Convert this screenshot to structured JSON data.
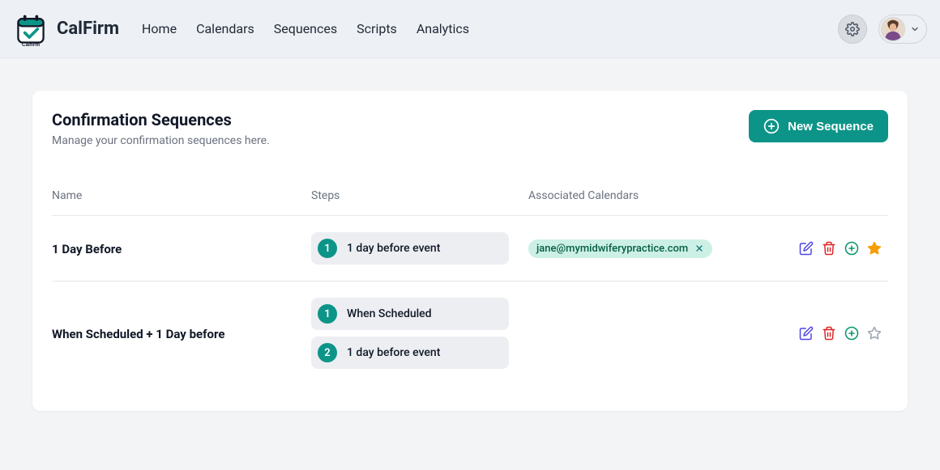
{
  "brand": "CalFirm",
  "nav": {
    "items": [
      "Home",
      "Calendars",
      "Sequences",
      "Scripts",
      "Analytics"
    ]
  },
  "page": {
    "title": "Confirmation Sequences",
    "subtitle": "Manage your confirmation sequences here.",
    "new_button": "New Sequence"
  },
  "table": {
    "headers": {
      "name": "Name",
      "steps": "Steps",
      "calendars": "Associated Calendars"
    },
    "rows": [
      {
        "name": "1 Day Before",
        "steps": [
          {
            "num": "1",
            "label": "1 day before event"
          }
        ],
        "calendars": [
          {
            "email": "jane@mymidwiferypractice.com"
          }
        ],
        "favorite": true
      },
      {
        "name": "When Scheduled + 1 Day before",
        "steps": [
          {
            "num": "1",
            "label": "When Scheduled"
          },
          {
            "num": "2",
            "label": "1 day before event"
          }
        ],
        "calendars": [],
        "favorite": false
      }
    ]
  }
}
